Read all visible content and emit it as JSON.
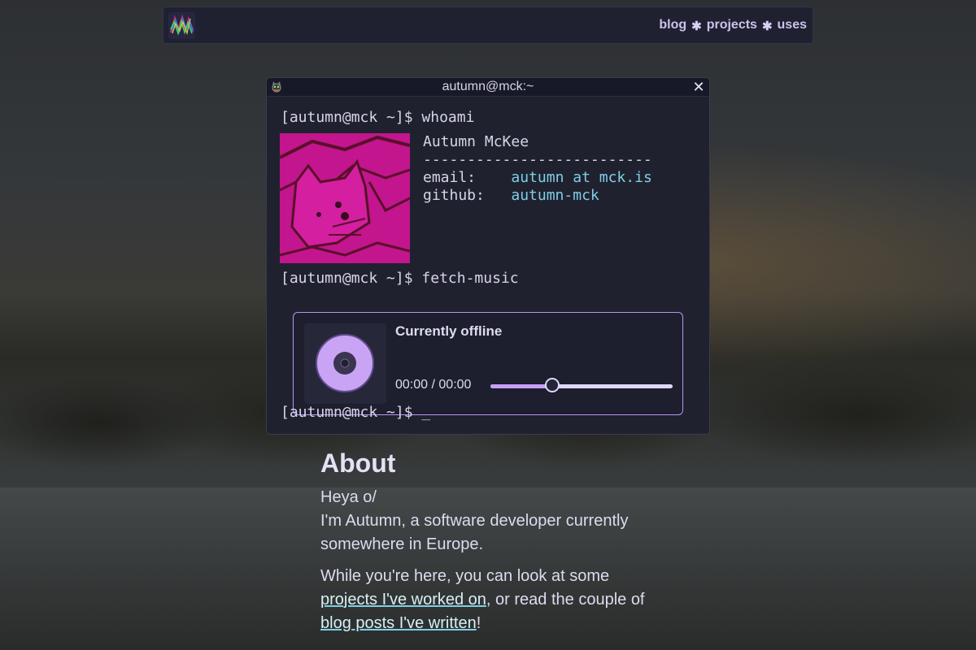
{
  "nav": {
    "links": [
      "blog",
      "projects",
      "uses"
    ],
    "separator": "✱"
  },
  "terminal": {
    "title": "autumn@mck:~",
    "prompt": "[autumn@mck ~]$",
    "commands": [
      "whoami",
      "fetch-music",
      "_"
    ],
    "profile": {
      "name": "Autumn McKee",
      "divider": "--------------------------",
      "email_label": "email:",
      "email_value": "autumn at mck.is",
      "github_label": "github:",
      "github_value": "autumn-mck"
    }
  },
  "player": {
    "status": "Currently offline",
    "current_time": "00:00",
    "time_separator": "/",
    "total_time": "00:00",
    "progress_percent": 34,
    "accent_color": "#c89ff5"
  },
  "about": {
    "heading": "About",
    "greeting": "Heya o/",
    "intro": "I'm Autumn, a software developer currently somewhere in Europe.",
    "outro_prefix": "While you're here, you can look at some",
    "projects_link": "projects I've worked on",
    "outro_middle": ", or read the couple of",
    "blog_link": "blog posts I've written",
    "outro_suffix": "!"
  }
}
